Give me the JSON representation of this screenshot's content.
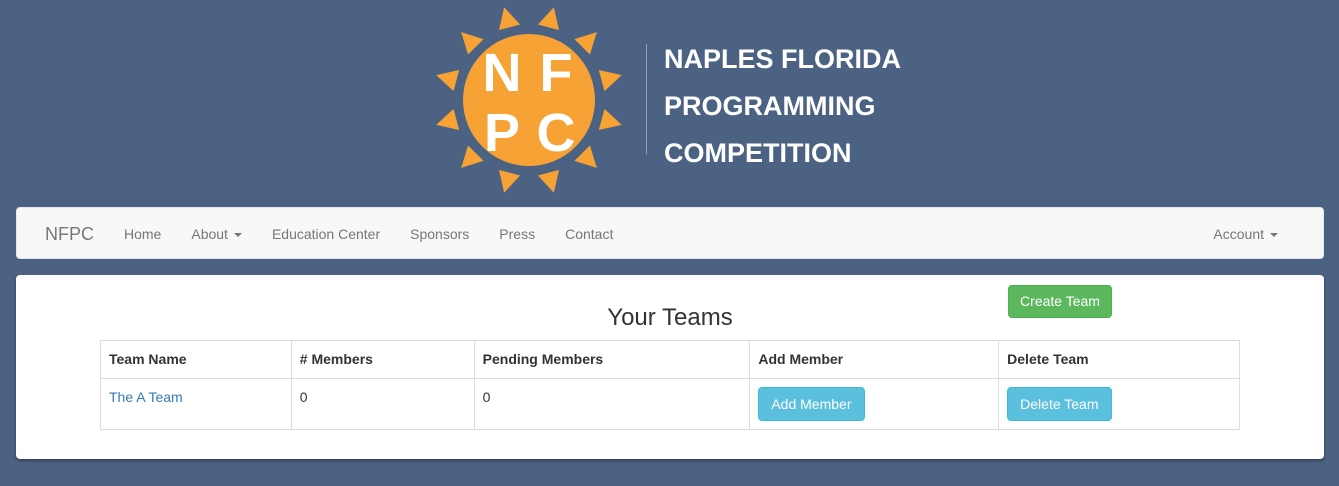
{
  "header": {
    "logo_letters": [
      "N",
      "F",
      "P",
      "C"
    ],
    "title_lines": [
      "NAPLES FLORIDA",
      "PROGRAMMING",
      "COMPETITION"
    ],
    "colors": {
      "sun": "#f7a234",
      "background": "#4c6283"
    }
  },
  "navbar": {
    "brand": "NFPC",
    "items": [
      {
        "label": "Home"
      },
      {
        "label": "About",
        "dropdown": true
      },
      {
        "label": "Education Center"
      },
      {
        "label": "Sponsors"
      },
      {
        "label": "Press"
      },
      {
        "label": "Contact"
      }
    ],
    "account": {
      "label": "Account",
      "dropdown": true
    }
  },
  "main": {
    "title": "Your Teams",
    "create_button": "Create Team",
    "table": {
      "headers": [
        "Team Name",
        "# Members",
        "Pending Members",
        "Add Member",
        "Delete Team"
      ],
      "rows": [
        {
          "team_name": "The A Team",
          "members": "0",
          "pending": "0",
          "add_label": "Add Member",
          "delete_label": "Delete Team"
        }
      ]
    }
  }
}
